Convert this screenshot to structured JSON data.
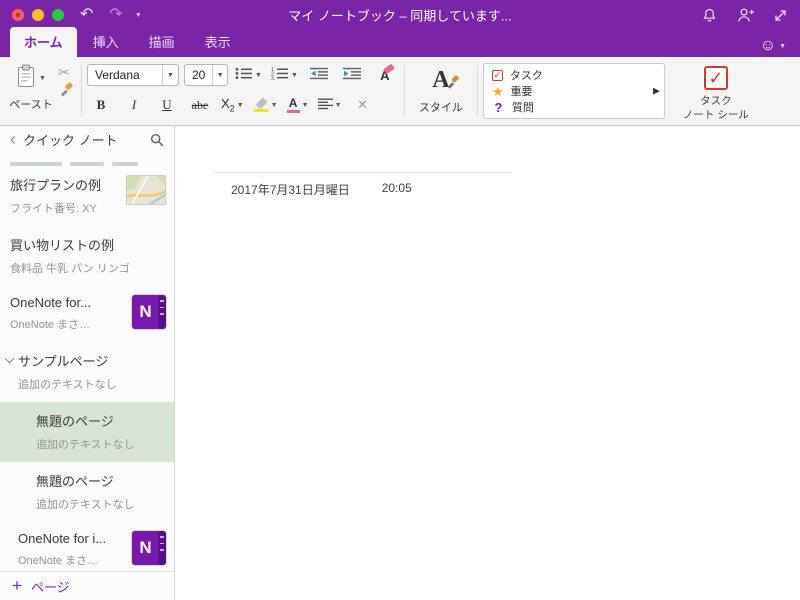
{
  "titlebar": {
    "title": "マイ ノートブック – 同期しています..."
  },
  "tabs": [
    {
      "label": "ホーム"
    },
    {
      "label": "挿入"
    },
    {
      "label": "描画"
    },
    {
      "label": "表示"
    }
  ],
  "ribbon": {
    "paste_label": "ペースト",
    "font_name": "Verdana",
    "font_size": "20",
    "bold": "B",
    "italic": "I",
    "underline": "U",
    "strikethrough": "abe",
    "subscript": "X",
    "subscript_sub": "2",
    "style_label": "スタイル",
    "tags": [
      {
        "label": "タスク"
      },
      {
        "label": "重要"
      },
      {
        "label": "質問"
      }
    ],
    "task_seal_line1": "タスク",
    "task_seal_line2": "ノート シール"
  },
  "sidebar": {
    "title": "クイック ノート",
    "pages": [
      {
        "title": "旅行プランの例",
        "subtitle": "フライト番号: XY"
      },
      {
        "title": "買い物リストの例",
        "subtitle": "食料品 牛乳 パン リンゴ"
      },
      {
        "title": "OneNote for...",
        "subtitle": "OneNote まさ…"
      },
      {
        "title": "サンプルページ",
        "subtitle": "追加のテキストなし"
      },
      {
        "title": "無題のページ",
        "subtitle": "追加のテキストなし"
      },
      {
        "title": "無題のページ",
        "subtitle": "追加のテキストなし"
      },
      {
        "title": "OneNote for i...",
        "subtitle": "OneNote まさ…"
      }
    ],
    "add_page_label": "ページ"
  },
  "content": {
    "date": "2017年7月31日月曜日",
    "time": "20:05"
  },
  "icons": {
    "smiley": "☺",
    "undo": "↶",
    "redo": "↷",
    "caret": "▼",
    "small_caret": "▾",
    "back": "‹",
    "scissors": "✂",
    "star": "★",
    "check": "✓",
    "question": "?",
    "expand_right": "▶",
    "plus": "+",
    "clear_x": "✕",
    "onenote_n": "N"
  }
}
